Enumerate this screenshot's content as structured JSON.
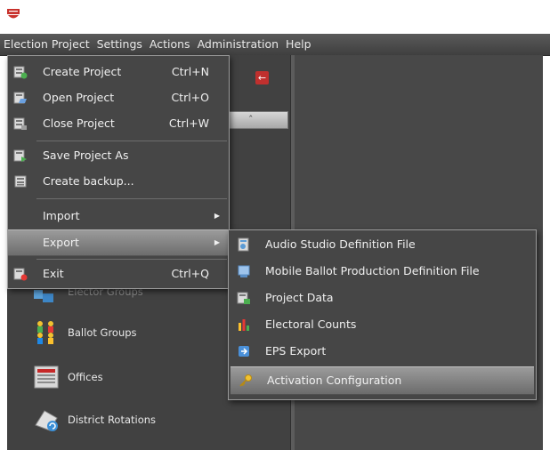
{
  "menubar": {
    "items": [
      "Election Project",
      "Settings",
      "Actions",
      "Administration",
      "Help"
    ]
  },
  "file_menu": {
    "items": [
      {
        "label": "Create Project",
        "shortcut": "Ctrl+N",
        "icon": "create-project-icon"
      },
      {
        "label": "Open Project",
        "shortcut": "Ctrl+O",
        "icon": "open-project-icon"
      },
      {
        "label": "Close Project",
        "shortcut": "Ctrl+W",
        "icon": "close-project-icon"
      },
      {
        "label": "Save Project As",
        "shortcut": "",
        "icon": "save-project-icon"
      },
      {
        "label": "Create backup...",
        "shortcut": "",
        "icon": "backup-icon"
      },
      {
        "label": "Import",
        "shortcut": "",
        "icon": ""
      },
      {
        "label": "Export",
        "shortcut": "",
        "icon": ""
      },
      {
        "label": "Exit",
        "shortcut": "Ctrl+Q",
        "icon": "exit-icon"
      }
    ]
  },
  "export_menu": {
    "items": [
      {
        "label": "Audio Studio Definition File",
        "icon": "audio-file-icon"
      },
      {
        "label": "Mobile Ballot Production Definition File",
        "icon": "mobile-ballot-icon"
      },
      {
        "label": "Project Data",
        "icon": "project-data-icon"
      },
      {
        "label": "Electoral Counts",
        "icon": "electoral-counts-icon"
      },
      {
        "label": "EPS Export",
        "icon": "eps-export-icon"
      },
      {
        "label": "Activation Configuration",
        "icon": "key-icon"
      }
    ]
  },
  "left_nav": {
    "items": [
      {
        "label": "Elector Groups",
        "icon": "elector-groups-icon"
      },
      {
        "label": "Ballot Groups",
        "icon": "ballot-groups-icon"
      },
      {
        "label": "Offices",
        "icon": "offices-icon"
      },
      {
        "label": "District Rotations",
        "icon": "district-rotations-icon"
      }
    ]
  },
  "colors": {
    "menubar_bg": "#4a4a4a",
    "menu_bg": "#464646",
    "highlight": "#8a8a8a",
    "back_button": "#c0302e"
  }
}
